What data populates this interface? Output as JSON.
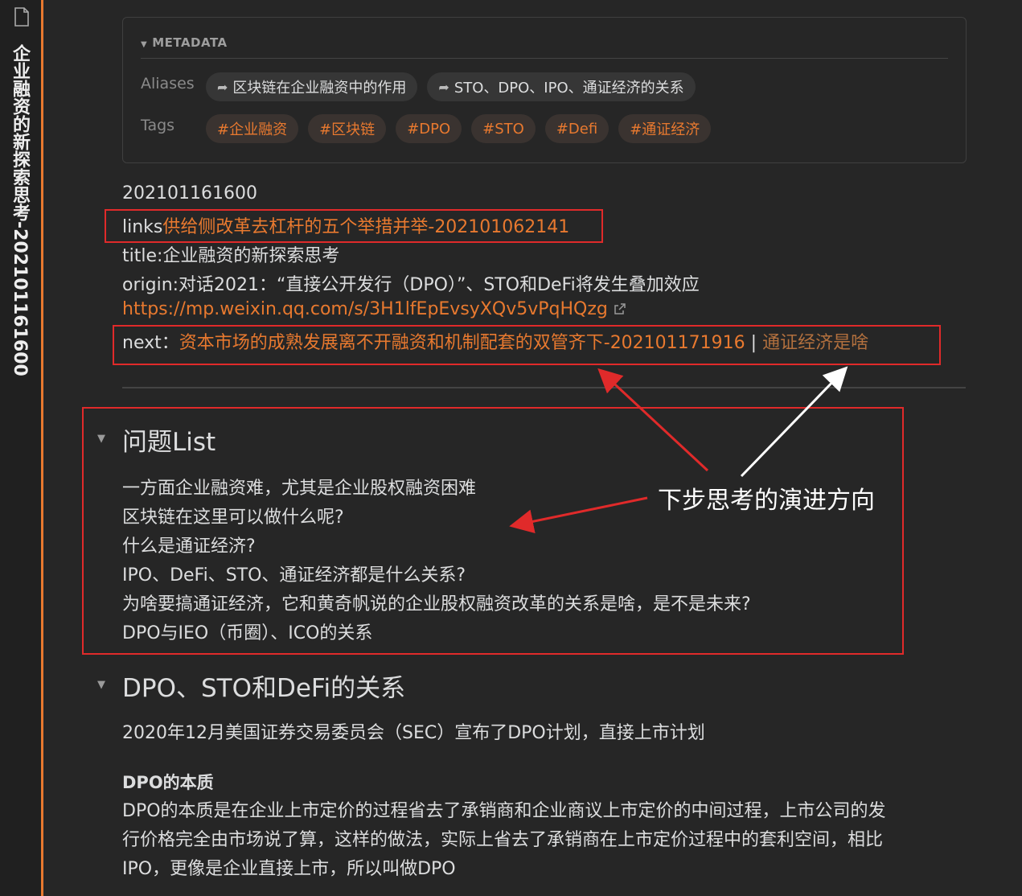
{
  "sidebar": {
    "vertical_title": "企业融资的新探索思考-202101161600"
  },
  "metadata": {
    "heading": "METADATA",
    "aliases_label": "Aliases",
    "aliases": [
      "区块链在企业融资中的作用",
      "STO、DPO、IPO、通证经济的关系"
    ],
    "tags_label": "Tags",
    "tags": [
      "#企业融资",
      "#区块链",
      "#DPO",
      "#STO",
      "#Defi",
      "#通证经济"
    ]
  },
  "header_lines": {
    "id": "202101161600",
    "links_prefix": "links",
    "links_target": "供给侧改革去杠杆的五个举措并举-202101062141",
    "title_line": "title:企业融资的新探索思考",
    "origin_line": "origin:对话2021：“直接公开发行（DPO）”、STO和DeFi将发生叠加效应",
    "url": "https://mp.weixin.qq.com/s/3H1lfEpEvsyXQv5vPqHQzg",
    "next_prefix": "next：",
    "next_link": "资本市场的成熟发展离不开融资和机制配套的双管齐下-202101171916",
    "next_separator": "|",
    "next_link2": "通证经济是啥"
  },
  "section1": {
    "heading": "问题List",
    "items": [
      "一方面企业融资难，尤其是企业股权融资困难",
      "区块链在这里可以做什么呢?",
      "什么是通证经济?",
      "IPO、DeFi、STO、通证经济都是什么关系?",
      "为啥要搞通证经济，它和黄奇帆说的企业股权融资改革的关系是啥，是不是未来?",
      "DPO与IEO（币圈）、ICO的关系"
    ]
  },
  "annotation": {
    "text": "下步思考的演进方向"
  },
  "section2": {
    "heading": "DPO、STO和DeFi的关系",
    "para1": "2020年12月美国证券交易委员会（SEC）宣布了DPO计划，直接上市计划",
    "bold_heading": "DPO的本质",
    "para2_lines": [
      "DPO的本质是在企业上市定价的过程省去了承销商和企业商议上市定价的中间过程，上市公司的发",
      "行价格完全由市场说了算，这样的做法，实际上省去了承销商在上市定价过程中的套利空间，相比",
      "IPO，更像是企业直接上市，所以叫做DPO"
    ]
  },
  "colors": {
    "accent": "#e8792f",
    "annotation_box": "#e02a2a",
    "background": "#262626"
  }
}
